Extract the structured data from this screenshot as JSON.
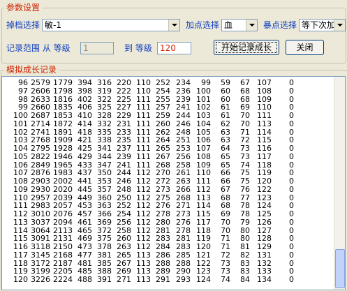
{
  "params": {
    "title": "参数设置",
    "drop_label": "掉档选择",
    "drop_value": "敏-1",
    "point_label": "加点选择",
    "point_value": "血",
    "crit_label": "暴点选择",
    "crit_value": "等下次加",
    "range_label": "记录范围  从  等级",
    "from_value": "1",
    "to_label": "到  等级",
    "to_value": "120",
    "start_button": "开始记录成长",
    "close_button": "关闭"
  },
  "records": {
    "title": "模拟成长记录",
    "rows": [
      [
        "96",
        "2579",
        "1779",
        "394",
        "316",
        "220",
        "110",
        "252",
        "234",
        "99",
        "59",
        "67",
        "107",
        "0"
      ],
      [
        "97",
        "2606",
        "1798",
        "398",
        "319",
        "222",
        "110",
        "254",
        "236",
        "100",
        "60",
        "68",
        "108",
        "0"
      ],
      [
        "98",
        "2633",
        "1816",
        "402",
        "322",
        "225",
        "111",
        "255",
        "239",
        "101",
        "60",
        "68",
        "109",
        "0"
      ],
      [
        "99",
        "2660",
        "1835",
        "406",
        "325",
        "227",
        "111",
        "257",
        "241",
        "102",
        "61",
        "69",
        "110",
        "0"
      ],
      [
        "100",
        "2687",
        "1853",
        "410",
        "328",
        "229",
        "111",
        "259",
        "244",
        "103",
        "61",
        "70",
        "111",
        "0"
      ],
      [
        "101",
        "2714",
        "1872",
        "414",
        "332",
        "231",
        "111",
        "260",
        "246",
        "104",
        "62",
        "70",
        "113",
        "0"
      ],
      [
        "102",
        "2741",
        "1891",
        "418",
        "335",
        "233",
        "111",
        "262",
        "248",
        "105",
        "63",
        "71",
        "114",
        "0"
      ],
      [
        "103",
        "2768",
        "1909",
        "421",
        "338",
        "235",
        "111",
        "264",
        "251",
        "106",
        "63",
        "72",
        "115",
        "0"
      ],
      [
        "104",
        "2795",
        "1928",
        "425",
        "341",
        "237",
        "111",
        "265",
        "253",
        "107",
        "64",
        "73",
        "116",
        "0"
      ],
      [
        "105",
        "2822",
        "1946",
        "429",
        "344",
        "239",
        "111",
        "267",
        "256",
        "108",
        "65",
        "73",
        "117",
        "0"
      ],
      [
        "106",
        "2849",
        "1965",
        "433",
        "347",
        "241",
        "111",
        "268",
        "258",
        "109",
        "65",
        "74",
        "118",
        "0"
      ],
      [
        "107",
        "2876",
        "1983",
        "437",
        "350",
        "244",
        "112",
        "270",
        "261",
        "110",
        "66",
        "75",
        "119",
        "0"
      ],
      [
        "108",
        "2903",
        "2002",
        "441",
        "353",
        "246",
        "112",
        "272",
        "263",
        "111",
        "66",
        "75",
        "120",
        "0"
      ],
      [
        "109",
        "2930",
        "2020",
        "445",
        "357",
        "248",
        "112",
        "273",
        "266",
        "112",
        "67",
        "76",
        "122",
        "0"
      ],
      [
        "110",
        "2957",
        "2039",
        "449",
        "360",
        "250",
        "112",
        "275",
        "268",
        "113",
        "68",
        "77",
        "123",
        "0"
      ],
      [
        "111",
        "2983",
        "2057",
        "453",
        "363",
        "252",
        "112",
        "276",
        "271",
        "114",
        "68",
        "78",
        "124",
        "0"
      ],
      [
        "112",
        "3010",
        "2076",
        "457",
        "366",
        "254",
        "112",
        "278",
        "273",
        "115",
        "69",
        "78",
        "125",
        "0"
      ],
      [
        "113",
        "3037",
        "2094",
        "461",
        "369",
        "256",
        "112",
        "280",
        "276",
        "117",
        "70",
        "79",
        "126",
        "0"
      ],
      [
        "114",
        "3064",
        "2113",
        "465",
        "372",
        "258",
        "112",
        "281",
        "278",
        "118",
        "70",
        "80",
        "127",
        "0"
      ],
      [
        "115",
        "3091",
        "2131",
        "469",
        "375",
        "260",
        "112",
        "283",
        "281",
        "119",
        "71",
        "80",
        "128",
        "0"
      ],
      [
        "116",
        "3118",
        "2150",
        "473",
        "378",
        "263",
        "112",
        "284",
        "283",
        "120",
        "71",
        "81",
        "129",
        "0"
      ],
      [
        "117",
        "3145",
        "2168",
        "477",
        "381",
        "265",
        "113",
        "286",
        "285",
        "121",
        "72",
        "82",
        "131",
        "0"
      ],
      [
        "118",
        "3172",
        "2187",
        "481",
        "385",
        "267",
        "113",
        "288",
        "288",
        "122",
        "73",
        "83",
        "132",
        "0"
      ],
      [
        "119",
        "3199",
        "2205",
        "485",
        "388",
        "269",
        "113",
        "289",
        "290",
        "123",
        "73",
        "83",
        "133",
        "0"
      ],
      [
        "120",
        "3226",
        "2224",
        "488",
        "391",
        "271",
        "113",
        "291",
        "293",
        "124",
        "74",
        "84",
        "134",
        "0"
      ]
    ]
  }
}
